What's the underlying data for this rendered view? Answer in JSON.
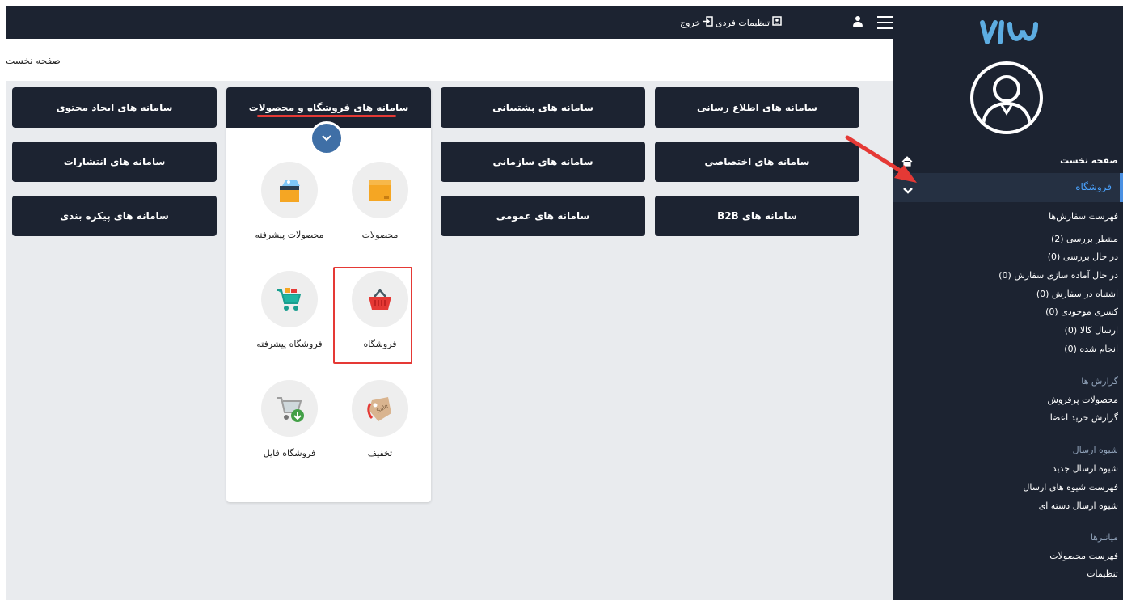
{
  "topbar": {
    "logout_label": "خروج",
    "settings_label": "تنظیمات فردی"
  },
  "breadcrumb": {
    "label": "صفحه نخست"
  },
  "tiles": {
    "notification": "سامانه های اطلاع رسانی",
    "support": "سامانه های پشتیبانی",
    "store_products": "سامانه های فروشگاه و محصولات",
    "content": "سامانه های ایجاد محتوی",
    "exclusive": "سامانه های اختصاصی",
    "organizational": "سامانه های سازمانی",
    "publishing": "سامانه های انتشارات",
    "b2b": "سامانه های B2B",
    "general": "سامانه های عمومی",
    "config": "سامانه های پیکره بندی"
  },
  "apps": {
    "products": "محصولات",
    "advanced_products": "محصولات پیشرفته",
    "store": "فروشگاه",
    "advanced_store": "فروشگاه پیشرفته",
    "discount": "تخفیف",
    "file_store": "فروشگاه فایل",
    "discount_tag_text": "Sale"
  },
  "sidebar": {
    "home": "صفحه نخست",
    "active": "فروشگاه",
    "orders_header": "فهرست سفارش‌ها",
    "orders": [
      "منتظر بررسی (2)",
      "در حال بررسی (0)",
      "در حال آماده سازی سفارش (0)",
      "اشتباه در سفارش (0)",
      "کسری موجودی (0)",
      "ارسال کالا (0)",
      "انجام شده (0)"
    ],
    "reports_header": "گزارش ها",
    "reports": [
      "محصولات پرفروش",
      "گزارش خرید اعضا"
    ],
    "shipping_header": "شیوه ارسال",
    "shipping": [
      "شیوه ارسال جدید",
      "فهرست شیوه های ارسال",
      "شیوه ارسال دسته ای"
    ],
    "shortcuts_header": "میانبرها",
    "shortcuts": [
      "فهرست محصولات",
      "تنظیمات"
    ]
  },
  "colors": {
    "navy": "#1c2331",
    "panel_bg": "#e9ebee",
    "accent_red": "#e53935",
    "active_blue": "#4aa3ff"
  }
}
